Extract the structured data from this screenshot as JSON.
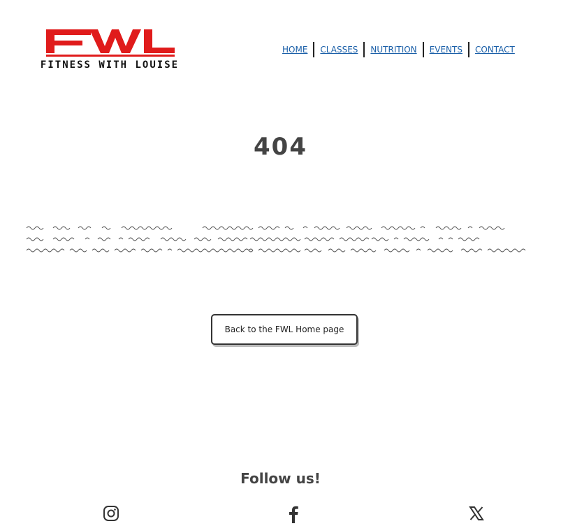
{
  "logo": {
    "main": "FWL",
    "subtitle": "FITNESS WITH LOUISE",
    "color": "#e01b1b"
  },
  "nav": {
    "items": [
      {
        "label": "HOME"
      },
      {
        "label": "CLASSES"
      },
      {
        "label": "NUTRITION"
      },
      {
        "label": "EVENTS"
      },
      {
        "label": "CONTACT"
      }
    ],
    "link_color": "#1a5fa8"
  },
  "error": {
    "code": "404"
  },
  "home_button": {
    "label": "Back to the FWL Home page"
  },
  "footer": {
    "heading": "Follow us!",
    "icons": [
      "instagram-icon",
      "facebook-icon",
      "x-icon"
    ]
  }
}
